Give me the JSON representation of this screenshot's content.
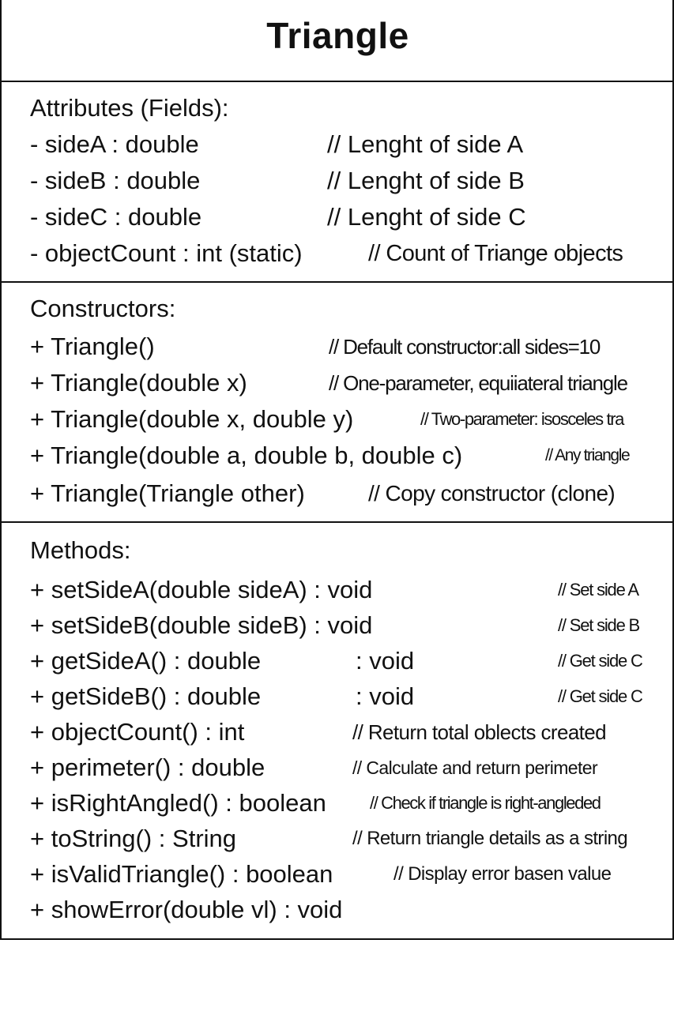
{
  "class_name": "Triangle",
  "attributes": {
    "heading": "Attributes (Fields):",
    "items": [
      {
        "sig": "- sideA : double",
        "comment": "// Lenght of side A"
      },
      {
        "sig": "- sideB : double",
        "comment": "// Lenght of side B"
      },
      {
        "sig": "- sideC : double",
        "comment": "// Lenght of side C"
      },
      {
        "sig": "- objectCount : int (static)",
        "comment": "// Count of Triange objects"
      }
    ]
  },
  "constructors": {
    "heading": "Constructors:",
    "items": [
      {
        "sig": "+ Triangle()",
        "comment": "// Default constructor:all sides=10"
      },
      {
        "sig": "+ Triangle(double x)",
        "comment": "// One-parameter, equiiateral triangle"
      },
      {
        "sig": "+ Triangle(double x, double y)",
        "comment": "// Two-parameter: isosceles tra"
      },
      {
        "sig": "+ Triangle(double a, double b, double c)",
        "comment": "// Any triangle"
      },
      {
        "sig": "+ Triangle(Triangle other)",
        "comment": "// Copy constructor (clone)"
      }
    ]
  },
  "methods": {
    "heading": "Methods:",
    "items": [
      {
        "sig": "+ setSideA(double sideA) : void",
        "comment": "// Set side A"
      },
      {
        "sig": "+ setSideB(double sideB) : void",
        "comment": "// Set side B"
      },
      {
        "sig": "+ getSideA() : double",
        "extra": ": void",
        "comment": "// Get side C"
      },
      {
        "sig": "+ getSideB() : double",
        "extra": ": void",
        "comment": "// Get side C"
      },
      {
        "sig": "+ objectCount() : int",
        "comment": "// Return total oblects created"
      },
      {
        "sig": "+ perimeter() : double",
        "comment": "// Calculate and return perimeter"
      },
      {
        "sig": "+ isRightAngled() : boolean",
        "comment": "// Check if triangle is right-angleded"
      },
      {
        "sig": "+ toString() : String",
        "comment": "// Return triangle details as a string"
      },
      {
        "sig": "+ isValidTriangle() : boolean",
        "comment": "// Display error basen value"
      },
      {
        "sig": "+ showError(double vl) : void"
      }
    ]
  }
}
